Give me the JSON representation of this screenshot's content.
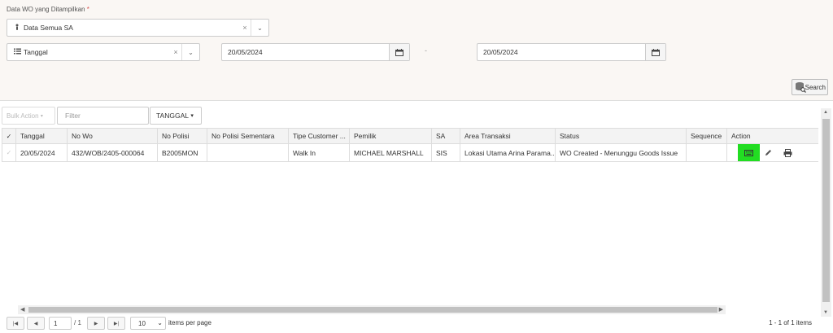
{
  "filters": {
    "label": "Data WO yang Ditampilkan",
    "required_mark": "*",
    "sa_select": {
      "icon": "person-icon",
      "value": "Data Semua SA",
      "clear": "×",
      "arrow": "⌄"
    },
    "date_type_select": {
      "icon": "list-icon",
      "value": "Tanggal",
      "clear": "×",
      "arrow": "⌄"
    },
    "date_from": "20/05/2024",
    "range_separator": "-",
    "date_to": "20/05/2024",
    "search_label": "Search"
  },
  "toolbar": {
    "bulk_action": "Bulk Action",
    "filter_placeholder": "Filter",
    "tanggal_button": "TANGGAL"
  },
  "grid": {
    "columns": [
      "Tanggal",
      "No Wo",
      "No Polisi",
      "No Polisi Sementara",
      "Tipe Customer ...",
      "Pemilik",
      "SA",
      "Area Transaksi",
      "Status",
      "Sequence",
      "Action"
    ],
    "rows": [
      {
        "tanggal": "20/05/2024",
        "no_wo": "432/WOB/2405-000064",
        "no_polisi": "B2005MON",
        "no_polisi_sementara": "",
        "tipe_customer": "Walk In",
        "pemilik": "MICHAEL MARSHALL",
        "sa": "SIS",
        "area_transaksi": "Lokasi Utama Arina Parama...",
        "status": "WO Created - Menunggu Goods Issue",
        "sequence": ""
      }
    ],
    "highlight_color": "#22dd22"
  },
  "pager": {
    "page": "1",
    "of": "/ 1",
    "page_size": "10",
    "items_per_page": "items per page",
    "info": "1 - 1 of 1 items"
  }
}
